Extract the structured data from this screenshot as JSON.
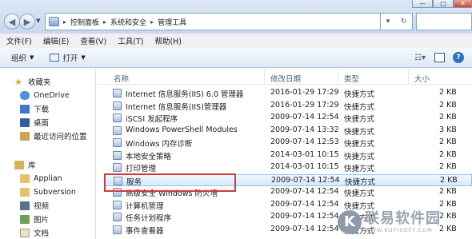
{
  "address": {
    "crumbs": [
      "控制面板",
      "系统和安全",
      "管理工具"
    ]
  },
  "window": {
    "minimize": "—",
    "maximize": "□",
    "close": "✕"
  },
  "menu": [
    "文件(F)",
    "编辑(E)",
    "查看(V)",
    "工具(T)",
    "帮助(H)"
  ],
  "toolbar": {
    "organize": "组织",
    "open": "打开"
  },
  "sidebar": {
    "favorites": "收藏夹",
    "fav_items": [
      "OneDrive",
      "下载",
      "桌面",
      "最近访问的位置"
    ],
    "library": "库",
    "lib_items": [
      "Applian",
      "Subversion",
      "视频",
      "图片",
      "文档"
    ]
  },
  "columns": {
    "name": "名称",
    "date": "修改日期",
    "type": "类型",
    "size": "大小"
  },
  "files": [
    {
      "name": "Internet 信息服务(IIS) 6.0 管理器",
      "date": "2016-01-29 17:29",
      "type": "快捷方式",
      "size": "2 KB"
    },
    {
      "name": "Internet 信息服务(IIS)管理器",
      "date": "2016-01-29 17:29",
      "type": "快捷方式",
      "size": "2 KB"
    },
    {
      "name": "iSCSI 发起程序",
      "date": "2009-07-14 12:54",
      "type": "快捷方式",
      "size": "2 KB"
    },
    {
      "name": "Windows PowerShell Modules",
      "date": "2009-07-14 13:32",
      "type": "快捷方式",
      "size": "3 KB"
    },
    {
      "name": "Windows 内存诊断",
      "date": "2009-07-14 12:53",
      "type": "快捷方式",
      "size": "2 KB"
    },
    {
      "name": "本地安全策略",
      "date": "2014-03-01 10:15",
      "type": "快捷方式",
      "size": "2 KB"
    },
    {
      "name": "打印管理",
      "date": "2014-03-01 10:15",
      "type": "快捷方式",
      "size": "2 KB"
    },
    {
      "name": "服务",
      "date": "2009-07-14 12:54",
      "type": "快捷方式",
      "size": "2 KB"
    },
    {
      "name": "高级安全 Windows 防火墙",
      "date": "2009-07-14 12:54",
      "type": "快捷方式",
      "size": "2 KB"
    },
    {
      "name": "计算机管理",
      "date": "2009-07-14 12:54",
      "type": "快捷方式",
      "size": "2 KB"
    },
    {
      "name": "任务计划程序",
      "date": "2009-07-14 12:54",
      "type": "快捷方式",
      "size": "2 KB"
    },
    {
      "name": "事件查看器",
      "date": "2009-07-14 12:54",
      "type": "快捷方式",
      "size": "2 KB"
    }
  ],
  "watermark": {
    "title": "联易软件园",
    "url": "WWW.KUYISOFT.COM"
  }
}
